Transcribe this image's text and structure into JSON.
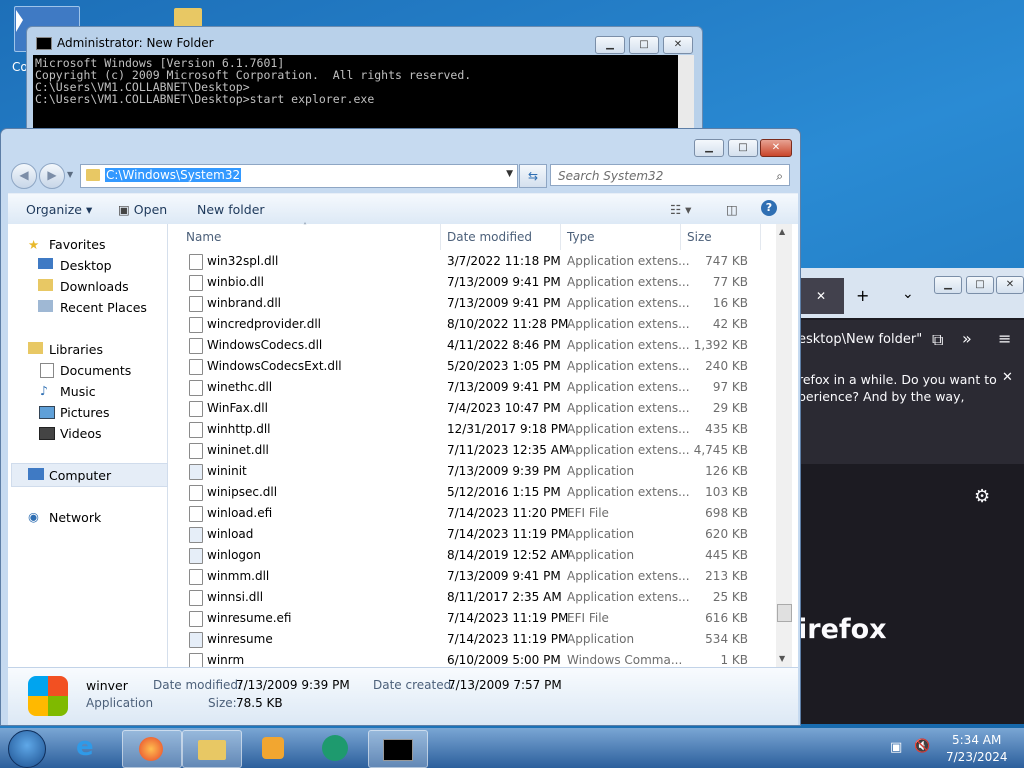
{
  "cmd": {
    "title": "Administrator: New Folder",
    "lines": [
      "Microsoft Windows [Version 6.1.7601]",
      "Copyright (c) 2009 Microsoft Corporation.  All rights reserved.",
      "",
      "C:\\Users\\VM1.COLLABNET\\Desktop>",
      "C:\\Users\\VM1.COLLABNET\\Desktop>start explorer.exe"
    ]
  },
  "desktop": {
    "icon_label_partial": "Co"
  },
  "explorer": {
    "address": "C:\\Windows\\System32",
    "search_placeholder": "Search System32",
    "toolbar": {
      "organize": "Organize",
      "open": "Open",
      "new_folder": "New folder"
    },
    "nav": {
      "favorites": "Favorites",
      "desktop": "Desktop",
      "downloads": "Downloads",
      "recent": "Recent Places",
      "libraries": "Libraries",
      "documents": "Documents",
      "music": "Music",
      "pictures": "Pictures",
      "videos": "Videos",
      "computer": "Computer",
      "network": "Network"
    },
    "columns": {
      "name": "Name",
      "date": "Date modified",
      "type": "Type",
      "size": "Size"
    },
    "rows": [
      {
        "name": "win32spl.dll",
        "date": "3/7/2022 11:18 PM",
        "type": "Application extens...",
        "size": "747 KB"
      },
      {
        "name": "winbio.dll",
        "date": "7/13/2009 9:41 PM",
        "type": "Application extens...",
        "size": "77 KB"
      },
      {
        "name": "winbrand.dll",
        "date": "7/13/2009 9:41 PM",
        "type": "Application extens...",
        "size": "16 KB"
      },
      {
        "name": "wincredprovider.dll",
        "date": "8/10/2022 11:28 PM",
        "type": "Application extens...",
        "size": "42 KB"
      },
      {
        "name": "WindowsCodecs.dll",
        "date": "4/11/2022 8:46 PM",
        "type": "Application extens...",
        "size": "1,392 KB"
      },
      {
        "name": "WindowsCodecsExt.dll",
        "date": "5/20/2023 1:05 PM",
        "type": "Application extens...",
        "size": "240 KB"
      },
      {
        "name": "winethc.dll",
        "date": "7/13/2009 9:41 PM",
        "type": "Application extens...",
        "size": "97 KB"
      },
      {
        "name": "WinFax.dll",
        "date": "7/4/2023 10:47 PM",
        "type": "Application extens...",
        "size": "29 KB"
      },
      {
        "name": "winhttp.dll",
        "date": "12/31/2017 9:18 PM",
        "type": "Application extens...",
        "size": "435 KB"
      },
      {
        "name": "wininet.dll",
        "date": "7/11/2023 12:35 AM",
        "type": "Application extens...",
        "size": "4,745 KB"
      },
      {
        "name": "wininit",
        "date": "7/13/2009 9:39 PM",
        "type": "Application",
        "size": "126 KB"
      },
      {
        "name": "winipsec.dll",
        "date": "5/12/2016 1:15 PM",
        "type": "Application extens...",
        "size": "103 KB"
      },
      {
        "name": "winload.efi",
        "date": "7/14/2023 11:20 PM",
        "type": "EFI File",
        "size": "698 KB"
      },
      {
        "name": "winload",
        "date": "7/14/2023 11:19 PM",
        "type": "Application",
        "size": "620 KB"
      },
      {
        "name": "winlogon",
        "date": "8/14/2019 12:52 AM",
        "type": "Application",
        "size": "445 KB"
      },
      {
        "name": "winmm.dll",
        "date": "7/13/2009 9:41 PM",
        "type": "Application extens...",
        "size": "213 KB"
      },
      {
        "name": "winnsi.dll",
        "date": "8/11/2017 2:35 AM",
        "type": "Application extens...",
        "size": "25 KB"
      },
      {
        "name": "winresume.efi",
        "date": "7/14/2023 11:19 PM",
        "type": "EFI File",
        "size": "616 KB"
      },
      {
        "name": "winresume",
        "date": "7/14/2023 11:19 PM",
        "type": "Application",
        "size": "534 KB"
      },
      {
        "name": "winrm",
        "date": "6/10/2009 5:00 PM",
        "type": "Windows Comma...",
        "size": "1 KB"
      }
    ],
    "details": {
      "name": "winver",
      "kind": "Application",
      "date_modified_label": "Date modified:",
      "date_modified": "7/13/2009 9:39 PM",
      "date_created_label": "Date created:",
      "date_created": "7/13/2009 7:57 PM",
      "size_label": "Size:",
      "size": "78.5 KB"
    }
  },
  "firefox": {
    "path_fragment": "esktop\\New folder\"",
    "notice_line1": "refox in a while. Do you want to",
    "notice_line2": "perience? And by the way,",
    "brand_fragment": "irefox"
  },
  "taskbar": {
    "time": "5:34 AM",
    "date": "7/23/2024"
  },
  "colors": {
    "cmd_bg": "#000000",
    "selection": "#3399ff",
    "firefox_bg": "#1c1b22",
    "close": "#c9462b"
  }
}
